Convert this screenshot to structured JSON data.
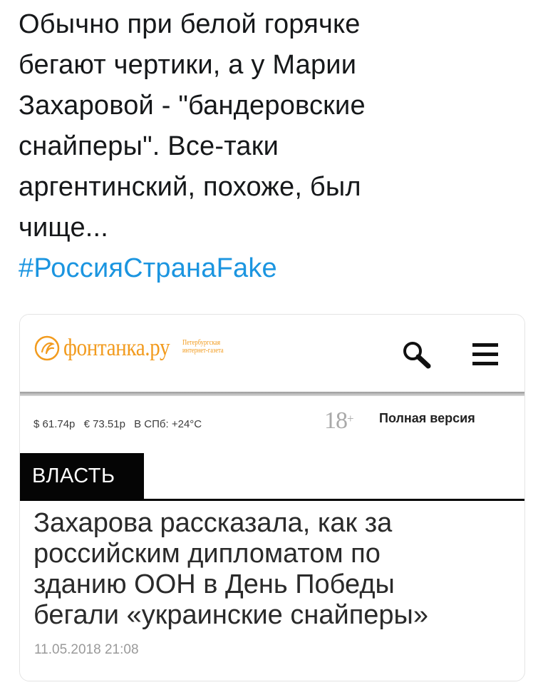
{
  "tweet": {
    "lines": [
      "Обычно при белой горячке",
      "бегают чертики, а у Марии",
      "Захаровой - \"бандеровские",
      "снайперы\". Все-таки",
      "аргентинский, похоже, был",
      "чище..."
    ],
    "hashtag": "#РоссияСтранаFake"
  },
  "card": {
    "site": {
      "logo_text": "фонтанка.ру",
      "tagline": [
        "Петербургская",
        "интернет-газета"
      ],
      "brand_color": "#f29b1e",
      "icons": [
        "search-icon",
        "menu-icon"
      ]
    },
    "info": {
      "usd": "$ 61.74р",
      "eur": "€ 73.51р",
      "weather": "В СПб: +24°C",
      "age_rating": "18",
      "age_plus": "+",
      "full_version": "Полная версия"
    },
    "section": "ВЛАСТЬ",
    "headline": [
      "Захарова рассказала, как за",
      "российским дипломатом по",
      "зданию ООН в День Победы",
      "бегали «украинские снайперы»"
    ],
    "date": "11.05.2018 21:08"
  },
  "colors": {
    "hashtag": "#1b95e0",
    "text": "#16181a",
    "section_bg": "#050505"
  }
}
